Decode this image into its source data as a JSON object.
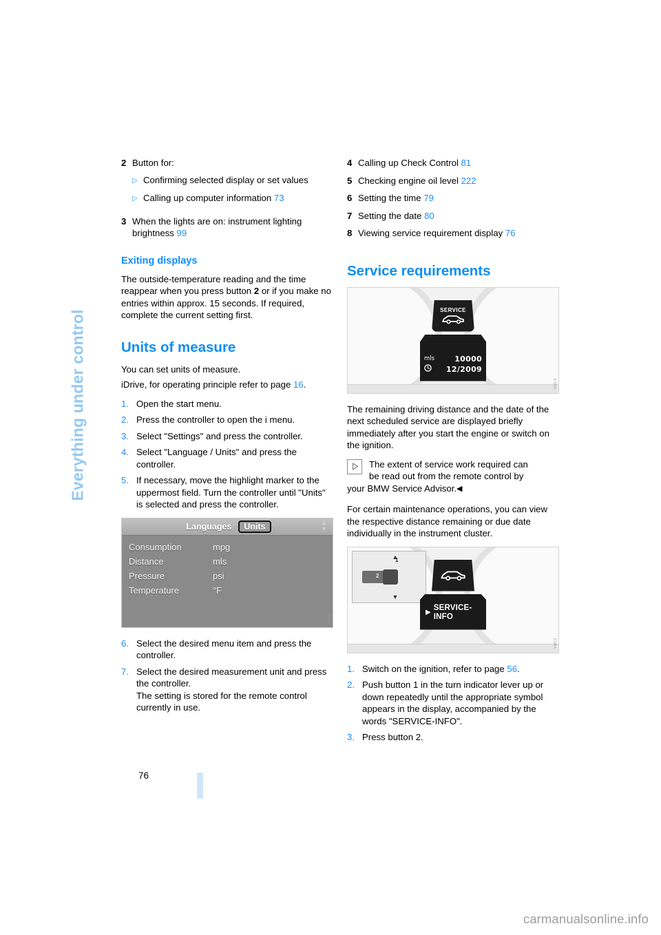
{
  "document": {
    "chapter_tab": "Everything under control",
    "page_number": "76",
    "watermark": "carmanualsonline.info"
  },
  "left_column": {
    "legend": [
      {
        "num": "2",
        "text": "Button for:",
        "sub_items": [
          {
            "text": "Confirming selected display or set values",
            "ref": ""
          },
          {
            "text": "Calling up computer information",
            "ref": "73"
          }
        ]
      },
      {
        "num": "3",
        "text": "When the lights are on: instrument lighting brightness",
        "ref": "99"
      }
    ],
    "exiting_displays": {
      "heading": "Exiting displays",
      "paragraph_part1": "The outside-temperature reading and the time reappear when you press button ",
      "paragraph_button": "2",
      "paragraph_part2": " or if you make no entries within approx. 15 seconds. If required, complete the current setting first."
    },
    "units_of_measure": {
      "heading": "Units of measure",
      "intro": "You can set units of measure.",
      "idrive_note_part1": "iDrive, for operating principle refer to page ",
      "idrive_note_ref": "16",
      "idrive_note_part2": ".",
      "steps": [
        {
          "num": "1.",
          "text": "Open the start menu."
        },
        {
          "num": "2.",
          "text": "Press the controller to open the i menu."
        },
        {
          "num": "3.",
          "text": "Select \"Settings\" and press the controller."
        },
        {
          "num": "4.",
          "text": "Select \"Language / Units\" and press the controller."
        },
        {
          "num": "5.",
          "text": "If necessary, move the highlight marker to the uppermost field. Turn the controller until \"Units\" is selected and press the controller."
        }
      ],
      "steps_after": [
        {
          "num": "6.",
          "text": "Select the desired menu item and press the controller."
        },
        {
          "num": "7.",
          "text": "Select the desired measurement unit and press the controller.\nThe setting is stored for the remote control currently in use."
        }
      ]
    },
    "idrive_figure": {
      "tab_languages": "Languages",
      "tab_units": "Units",
      "selected_tab": "Units",
      "rows": [
        {
          "label": "Consumption",
          "value": "mpg"
        },
        {
          "label": "Distance",
          "value": "mls"
        },
        {
          "label": "Pressure",
          "value": "psi"
        },
        {
          "label": "Temperature",
          "value": "°F"
        }
      ]
    }
  },
  "right_column": {
    "legend": [
      {
        "num": "4",
        "text": "Calling up Check Control",
        "ref": "81"
      },
      {
        "num": "5",
        "text": "Checking engine oil level",
        "ref": "222"
      },
      {
        "num": "6",
        "text": "Setting the time",
        "ref": "79"
      },
      {
        "num": "7",
        "text": "Setting the date",
        "ref": "80"
      },
      {
        "num": "8",
        "text": "Viewing service requirement display",
        "ref": "76"
      }
    ],
    "service_requirements": {
      "heading": "Service requirements",
      "paragraph1": "The remaining driving distance and the date of the next scheduled service are displayed briefly immediately after you start the engine or switch on the ignition.",
      "note_line1": "The extent of service work required can",
      "note_line2": "be read out from the remote control by",
      "note_line3": "your BMW Service Advisor.",
      "note_end_marker": "◀",
      "paragraph2": "For certain maintenance operations, you can view the respective distance remaining or due date individually in the instrument cluster.",
      "steps": [
        {
          "num": "1.",
          "text": "Switch on the ignition, refer to page ",
          "ref": "56",
          "suffix": "."
        },
        {
          "num": "2.",
          "text": "Push button 1 in the turn indicator lever up or down repeatedly until the appropriate symbol appears in the display, accompanied by the words \"SERVICE-INFO\"."
        },
        {
          "num": "3.",
          "text": "Press button 2."
        }
      ]
    },
    "service_figure": {
      "lamp_label": "SERVICE",
      "distance_unit": "mls",
      "distance_value": "10000",
      "date_value": "12/2009"
    },
    "service_info_figure": {
      "display_text_line1": "SERVICE-",
      "display_text_line2": "INFO",
      "lever_marker_1": "1",
      "lever_marker_2": "2"
    }
  },
  "colors": {
    "accent_blue": "#0f8ef2",
    "tab_blue": "#93c9f2",
    "page_mark_blue": "#cfe6fa"
  }
}
